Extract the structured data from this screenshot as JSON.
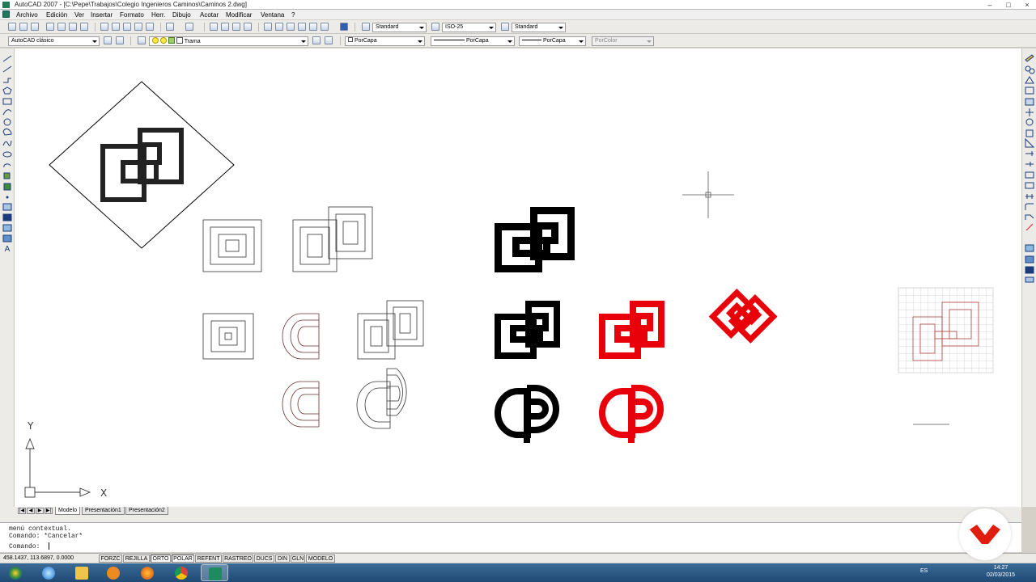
{
  "window": {
    "title": "AutoCAD 2007 - [C:\\Pepe\\Trabajos\\Colegio Ingenieros Caminos\\Caminos 2.dwg]",
    "minimize": "–",
    "restore": "□",
    "close": "×"
  },
  "menu": [
    "Archivo",
    "Edición",
    "Ver",
    "Insertar",
    "Formato",
    "Herr.",
    "Dibujo",
    "Acotar",
    "Modificar",
    "Ventana",
    "?"
  ],
  "styles": {
    "text_style": "Standard",
    "dim_style": "ISO-25",
    "table_style": "Standard"
  },
  "workspace": "AutoCAD clásico",
  "layer": "Trama",
  "properties": {
    "color": "PorCapa",
    "linetype": "PorCapa",
    "lineweight": "PorCapa",
    "plotstyle": "PorColor"
  },
  "ucs": {
    "x_label": "X",
    "y_label": "Y"
  },
  "text_tool": "A",
  "tabs": [
    "Modelo",
    "Presentación1",
    "Presentación2"
  ],
  "command": {
    "history": [
      "menú contextual.",
      "Comando: *Cancelar*"
    ],
    "prompt": "Comando:"
  },
  "status": {
    "coords": "458.1437, 113.6897, 0.0000",
    "toggles": [
      "FORZC",
      "REJILLA",
      "ORTO",
      "POLAR",
      "REFENT",
      "RASTREO",
      "DUCS",
      "DIN",
      "GLN",
      "MODELO"
    ]
  },
  "tray": {
    "lang": "ES",
    "time": "14:27",
    "date": "02/03/2015"
  },
  "colors": {
    "accent_red": "#e8000a",
    "taskbar": "#2a5a85"
  }
}
